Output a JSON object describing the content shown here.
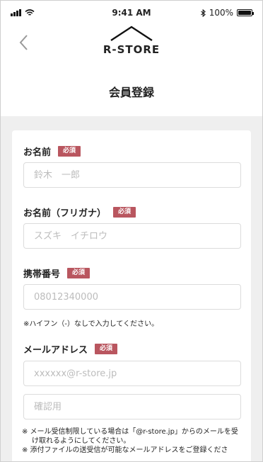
{
  "status_bar": {
    "time": "9:41 AM",
    "battery_percent": "100%",
    "battery_level": 1.0
  },
  "header": {
    "logo_text": "R-STORE",
    "title": "会員登録"
  },
  "required_label": "必須",
  "fields": [
    {
      "label": "お名前",
      "placeholder": "鈴木　一郎",
      "value": ""
    },
    {
      "label": "お名前（フリガナ）",
      "placeholder": "スズキ　イチロウ",
      "value": ""
    },
    {
      "label": "携帯番号",
      "placeholder": "08012340000",
      "value": "",
      "help": "※ハイフン（-）なしで入力してください。"
    },
    {
      "label": "メールアドレス",
      "placeholder": "xxxxxx@r-store.jp",
      "value": "",
      "confirm_placeholder": "確認用"
    }
  ],
  "notes": [
    "※ メール受信制限している場合は「@r-store.jp」からのメールを受け取れるようにしてください。",
    "※ 添付ファイルの送受信が可能なメールアドレスをご登録くださ"
  ],
  "icons": {
    "back": "chevron-left-icon",
    "logo": "house-roof-icon",
    "signal": "signal-icon",
    "wifi": "wifi-icon",
    "bluetooth": "bluetooth-icon",
    "battery": "battery-icon"
  }
}
